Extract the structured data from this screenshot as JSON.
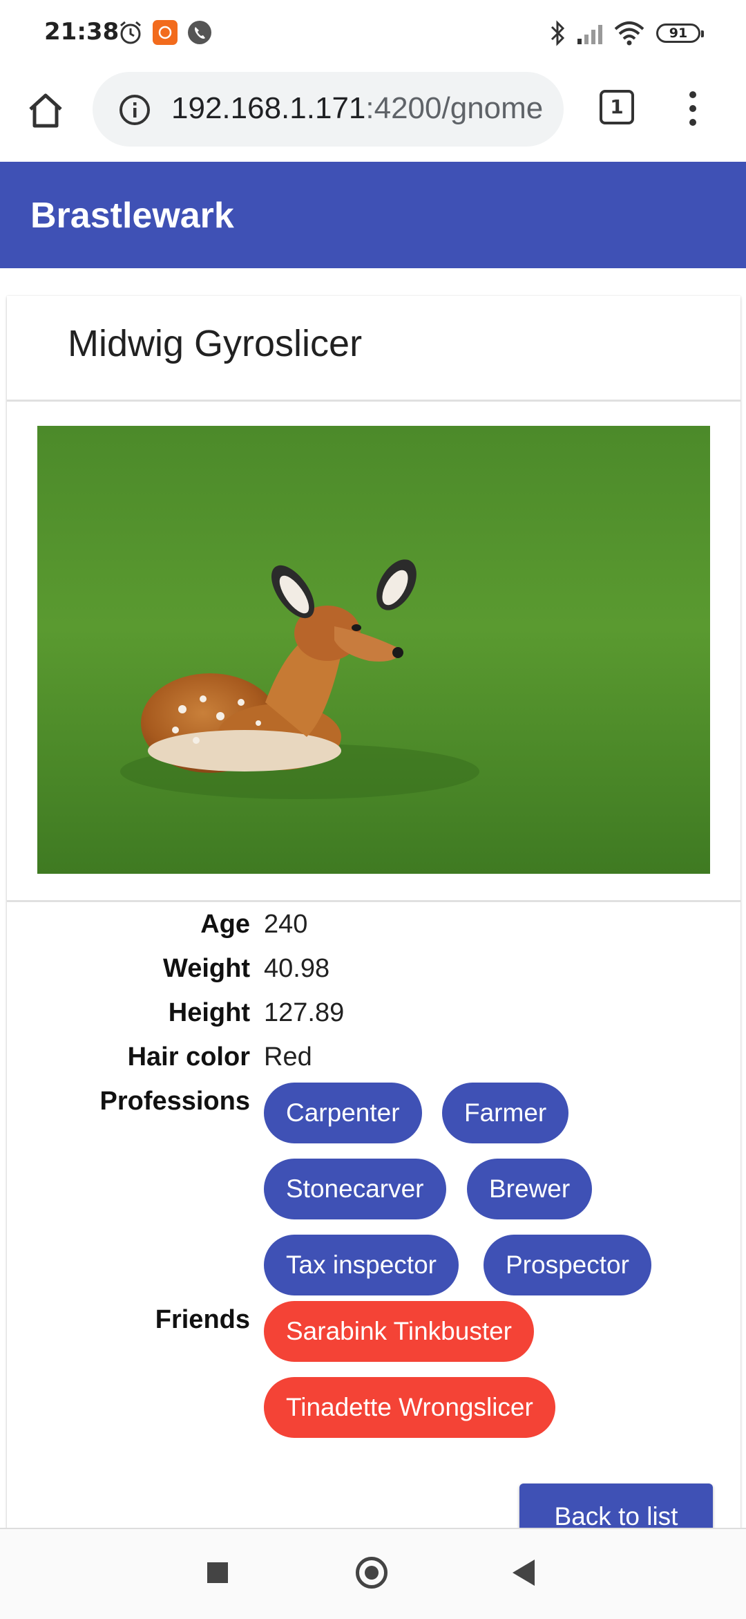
{
  "status_bar": {
    "time": "21:38",
    "battery": "91",
    "icons": [
      "alarm-icon",
      "app-notification-icon",
      "phone-icon",
      "bluetooth-icon",
      "signal-icon",
      "wifi-icon",
      "battery-icon"
    ]
  },
  "browser": {
    "url_host": "192.168.1.171",
    "url_path": ":4200/gnome",
    "tab_count": "1"
  },
  "app": {
    "title": "Brastlewark"
  },
  "gnome": {
    "name": "Midwig Gyroslicer",
    "attributes": [
      {
        "label": "Age",
        "value": "240"
      },
      {
        "label": "Weight",
        "value": "40.98"
      },
      {
        "label": "Height",
        "value": "127.89"
      },
      {
        "label": "Hair color",
        "value": "Red"
      }
    ],
    "professions_label": "Professions",
    "professions": [
      "Carpenter",
      "Farmer",
      "Stonecarver",
      "Brewer",
      "Tax inspector",
      "Prospector"
    ],
    "friends_label": "Friends",
    "friends": [
      "Sarabink Tinkbuster",
      "Tinadette Wrongslicer"
    ]
  },
  "actions": {
    "back_label": "Back to list"
  },
  "colors": {
    "primary": "#3f51b5",
    "accent": "#f44336"
  }
}
